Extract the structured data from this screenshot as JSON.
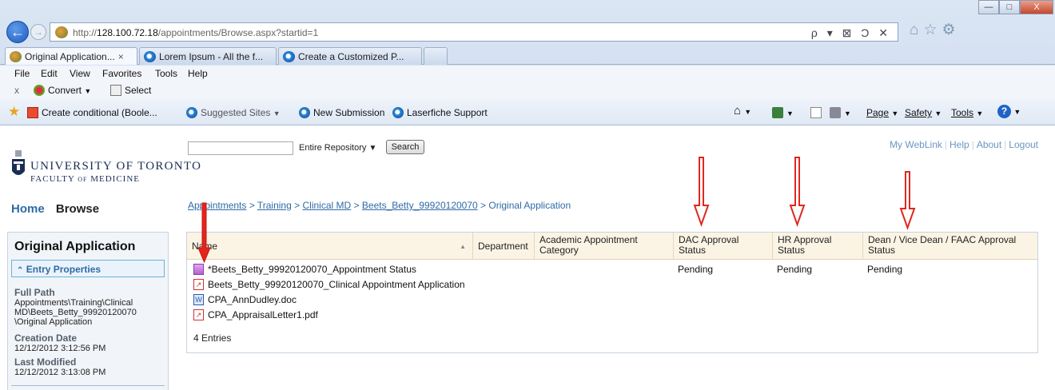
{
  "window": {
    "minimize": "—",
    "maximize": "□",
    "close": "X"
  },
  "address_bar": {
    "url_prefix": "http://",
    "url_host": "128.100.72.18",
    "url_path": "/appointments/Browse.aspx?startid=1",
    "tools": "ρ ▾ ⊠ Ͻ ✕"
  },
  "tabs": [
    {
      "label": "Original Application...",
      "close": "×",
      "icon": "uoft-favicon"
    },
    {
      "label": "Lorem Ipsum - All the f...",
      "icon": "ie-icon"
    },
    {
      "label": "Create a Customized P...",
      "icon": "ie-icon"
    }
  ],
  "menu": [
    "File",
    "Edit",
    "View",
    "Favorites",
    "Tools",
    "Help"
  ],
  "command_bar": {
    "close": "x",
    "convert": "Convert",
    "select": "Select"
  },
  "favorites_bar": {
    "items": [
      "Create conditional (Boole...",
      "Suggested Sites",
      "New Submission",
      "Laserfiche Support"
    ],
    "right_items": [
      "Page",
      "Safety",
      "Tools"
    ]
  },
  "logo": {
    "university": "UNIVERSITY OF TORONTO",
    "faculty_a": "FACULTY",
    "faculty_of": "OF",
    "faculty_b": "MEDICINE"
  },
  "search": {
    "value": "",
    "scope": "Entire Repository",
    "button": "Search"
  },
  "top_links": [
    "My WebLink",
    "Help",
    "About",
    "Logout"
  ],
  "page_nav": {
    "home": "Home",
    "browse": "Browse"
  },
  "breadcrumb": {
    "items": [
      "Appointments",
      "Training",
      "Clinical MD",
      "Beets_Betty_99920120070"
    ],
    "current": "Original Application",
    "separator": ">"
  },
  "sidebar": {
    "title": "Original Application",
    "section": "Entry Properties",
    "full_path_label": "Full Path",
    "full_path_lines": [
      "Appointments\\Training\\Clinical",
      "MD\\Beets_Betty_99920120070",
      "\\Original Application"
    ],
    "creation_label": "Creation Date",
    "creation_value": "12/12/2012 3:12:56 PM",
    "modified_label": "Last Modified",
    "modified_value": "12/12/2012 3:13:08 PM"
  },
  "table": {
    "columns": {
      "name": "Name",
      "department": "Department",
      "academic_a": "Academic Appointment",
      "academic_b": "Category",
      "dac_a": "DAC Approval",
      "dac_b": "Status",
      "hr_a": "HR Approval",
      "hr_b": "Status",
      "dean_a": "Dean / Vice Dean / FAAC Approval",
      "dean_b": "Status"
    },
    "rows": [
      {
        "name": "*Beets_Betty_99920120070_Appointment Status",
        "icon": "form-icon",
        "dac": "Pending",
        "hr": "Pending",
        "dean": "Pending"
      },
      {
        "name": "Beets_Betty_99920120070_Clinical Appointment Application",
        "icon": "pdf-icon",
        "dac": "",
        "hr": "",
        "dean": ""
      },
      {
        "name": "CPA_AnnDudley.doc",
        "icon": "word-icon",
        "dac": "",
        "hr": "",
        "dean": ""
      },
      {
        "name": "CPA_AppraisalLetter1.pdf",
        "icon": "pdf-icon",
        "dac": "",
        "hr": "",
        "dean": ""
      }
    ],
    "entry_count": "4 Entries"
  },
  "colors": {
    "link": "#2f6aa6",
    "annotation_arrow": "#e0271f",
    "header_bg": "#fbf4e4"
  }
}
